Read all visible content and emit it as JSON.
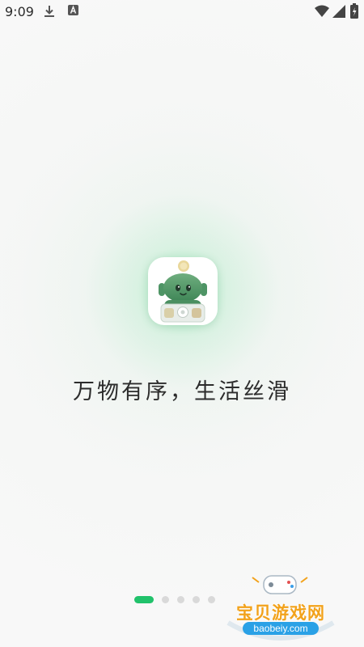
{
  "status_bar": {
    "time": "9:09",
    "left_icons": [
      "download-icon",
      "a-icon"
    ],
    "right_icons": [
      "wifi-icon",
      "signal-icon",
      "battery-icon"
    ]
  },
  "splash": {
    "app_icon": "robot-mascot-icon",
    "slogan": "万物有序，生活丝滑"
  },
  "pager": {
    "total": 5,
    "active_index": 0
  },
  "watermark": {
    "text": "宝贝游戏网",
    "url": "baobeiy.com"
  },
  "colors": {
    "accent": "#21c26b",
    "glow": "#66de96",
    "text": "#2c2c2c"
  }
}
